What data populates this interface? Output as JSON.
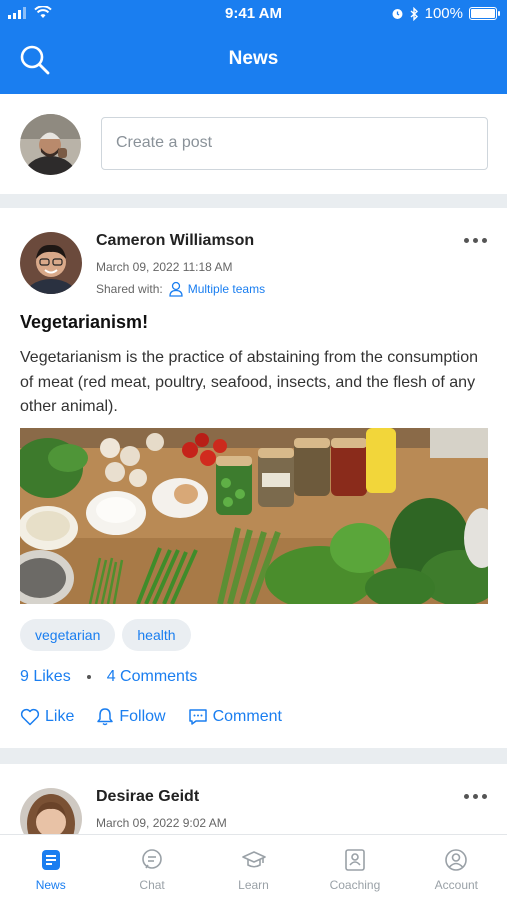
{
  "status_bar": {
    "time": "9:41 AM",
    "battery": "100%"
  },
  "header": {
    "title": "News",
    "search_icon": "search-icon"
  },
  "composer": {
    "placeholder": "Create a post"
  },
  "posts": [
    {
      "author": "Cameron Williamson",
      "datetime": "March 09, 2022 11:18 AM",
      "shared_label": "Shared with:",
      "shared_with": "Multiple teams",
      "title": "Vegetarianism!",
      "body": "Vegetarianism is the practice of abstaining from the consumption of meat (red meat, poultry, seafood, insects, and the flesh of any other animal).",
      "tags": [
        "vegetarian",
        "health"
      ],
      "likes": "9 Likes",
      "comments": "4 Comments",
      "actions": {
        "like": "Like",
        "follow": "Follow",
        "comment": "Comment"
      }
    },
    {
      "author": "Desirae Geidt",
      "datetime": "March 09, 2022 9:02 AM"
    }
  ],
  "tabbar": {
    "tabs": [
      {
        "label": "News",
        "icon": "news-icon",
        "active": true
      },
      {
        "label": "Chat",
        "icon": "chat-icon"
      },
      {
        "label": "Learn",
        "icon": "graduation-cap-icon"
      },
      {
        "label": "Coaching",
        "icon": "coaching-icon"
      },
      {
        "label": "Account",
        "icon": "account-icon"
      }
    ]
  },
  "colors": {
    "primary": "#1a7ef0",
    "background": "#e9edf0",
    "tag_bg": "#eaeef2"
  }
}
